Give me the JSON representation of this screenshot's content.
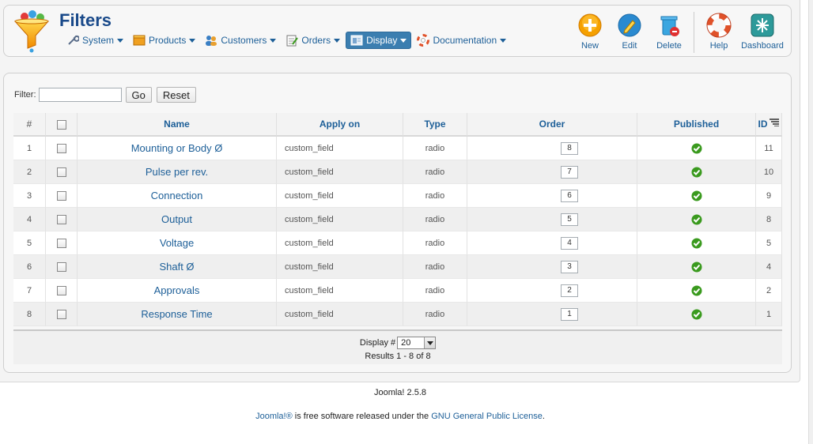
{
  "header": {
    "title": "Filters",
    "menu": [
      {
        "label": "System",
        "icon": "wrench-icon"
      },
      {
        "label": "Products",
        "icon": "box-icon"
      },
      {
        "label": "Customers",
        "icon": "users-icon"
      },
      {
        "label": "Orders",
        "icon": "order-icon"
      },
      {
        "label": "Display",
        "icon": "display-icon",
        "active": true
      },
      {
        "label": "Documentation",
        "icon": "lifebuoy-icon"
      }
    ],
    "toolbar": {
      "new_label": "New",
      "edit_label": "Edit",
      "delete_label": "Delete",
      "help_label": "Help",
      "dashboard_label": "Dashboard"
    }
  },
  "filter": {
    "label": "Filter:",
    "value": "",
    "go_label": "Go",
    "reset_label": "Reset"
  },
  "table": {
    "columns": [
      "#",
      "Name",
      "Apply on",
      "Type",
      "Order",
      "Published",
      "ID"
    ],
    "rows": [
      {
        "num": "1",
        "name": "Mounting or Body Ø",
        "apply_on": "custom_field",
        "type": "radio",
        "order": "8",
        "published": true,
        "id": "11"
      },
      {
        "num": "2",
        "name": "Pulse per rev.",
        "apply_on": "custom_field",
        "type": "radio",
        "order": "7",
        "published": true,
        "id": "10"
      },
      {
        "num": "3",
        "name": "Connection",
        "apply_on": "custom_field",
        "type": "radio",
        "order": "6",
        "published": true,
        "id": "9"
      },
      {
        "num": "4",
        "name": "Output",
        "apply_on": "custom_field",
        "type": "radio",
        "order": "5",
        "published": true,
        "id": "8"
      },
      {
        "num": "5",
        "name": "Voltage",
        "apply_on": "custom_field",
        "type": "radio",
        "order": "4",
        "published": true,
        "id": "5"
      },
      {
        "num": "6",
        "name": "Shaft Ø",
        "apply_on": "custom_field",
        "type": "radio",
        "order": "3",
        "published": true,
        "id": "4"
      },
      {
        "num": "7",
        "name": "Approvals",
        "apply_on": "custom_field",
        "type": "radio",
        "order": "2",
        "published": true,
        "id": "2"
      },
      {
        "num": "8",
        "name": "Response Time",
        "apply_on": "custom_field",
        "type": "radio",
        "order": "1",
        "published": true,
        "id": "1"
      }
    ]
  },
  "pagination": {
    "display_label": "Display #",
    "display_value": "20",
    "results": "Results 1 - 8 of 8"
  },
  "footer": {
    "version": "Joomla! 2.5.8",
    "joomla_link": "Joomla!®",
    "license_mid": " is free software released under the ",
    "license_link": "GNU General Public License",
    "license_end": "."
  },
  "colors": {
    "link": "#1d5f98",
    "title": "#1a4a8a",
    "active_menu": "#3b7eb0",
    "published": "#3a9a1e"
  }
}
